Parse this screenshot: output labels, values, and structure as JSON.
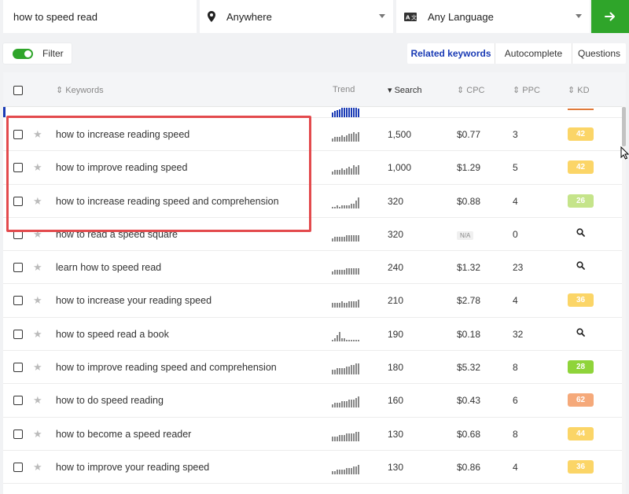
{
  "search": {
    "query": "how to speed read",
    "location": "Anywhere",
    "language": "Any Language"
  },
  "filter": {
    "label": "Filter",
    "enabled": true
  },
  "tabs": [
    {
      "label": "Related keywords",
      "active": true
    },
    {
      "label": "Autocomplete",
      "active": false
    },
    {
      "label": "Questions",
      "active": false
    }
  ],
  "table": {
    "headers": {
      "keywords": "Keywords",
      "trend": "Trend",
      "search": "Search",
      "cpc": "CPC",
      "ppc": "PPC",
      "kd": "KD"
    },
    "rows": [
      {
        "keyword": "how to increase reading speed",
        "search": "1,500",
        "cpc": "$0.77",
        "ppc": "3",
        "kd": "42",
        "kd_color": "#fbd567"
      },
      {
        "keyword": "how to improve reading speed",
        "search": "1,000",
        "cpc": "$1.29",
        "ppc": "5",
        "kd": "42",
        "kd_color": "#fbd567"
      },
      {
        "keyword": "how to increase reading speed and comprehension",
        "search": "320",
        "cpc": "$0.88",
        "ppc": "4",
        "kd": "26",
        "kd_color": "#c5e48a"
      },
      {
        "keyword": "how to read a speed square",
        "search": "320",
        "cpc": "N/A",
        "ppc": "0",
        "kd": "",
        "kd_color": ""
      },
      {
        "keyword": "learn how to speed read",
        "search": "240",
        "cpc": "$1.32",
        "ppc": "23",
        "kd": "",
        "kd_color": ""
      },
      {
        "keyword": "how to increase your reading speed",
        "search": "210",
        "cpc": "$2.78",
        "ppc": "4",
        "kd": "36",
        "kd_color": "#fbd567"
      },
      {
        "keyword": "how to speed read a book",
        "search": "190",
        "cpc": "$0.18",
        "ppc": "32",
        "kd": "",
        "kd_color": ""
      },
      {
        "keyword": "how to improve reading speed and comprehension",
        "search": "180",
        "cpc": "$5.32",
        "ppc": "8",
        "kd": "28",
        "kd_color": "#8fd43a"
      },
      {
        "keyword": "how to do speed reading",
        "search": "160",
        "cpc": "$0.43",
        "ppc": "6",
        "kd": "62",
        "kd_color": "#f5a97a"
      },
      {
        "keyword": "how to become a speed reader",
        "search": "130",
        "cpc": "$0.68",
        "ppc": "8",
        "kd": "44",
        "kd_color": "#fbd567"
      },
      {
        "keyword": "how to improve your reading speed",
        "search": "130",
        "cpc": "$0.86",
        "ppc": "4",
        "kd": "36",
        "kd_color": "#fbd567"
      }
    ]
  },
  "trend_patterns": [
    [
      2,
      3,
      3,
      3,
      4,
      3,
      4,
      5,
      5,
      6,
      5,
      6
    ],
    [
      2,
      3,
      3,
      3,
      4,
      3,
      4,
      5,
      4,
      6,
      5,
      6
    ],
    [
      1,
      1,
      2,
      1,
      2,
      2,
      2,
      2,
      3,
      3,
      5,
      7
    ],
    [
      2,
      3,
      3,
      3,
      3,
      3,
      4,
      4,
      4,
      4,
      4,
      4
    ],
    [
      2,
      3,
      3,
      3,
      3,
      3,
      4,
      4,
      4,
      4,
      4,
      4
    ],
    [
      3,
      3,
      3,
      3,
      4,
      3,
      3,
      4,
      4,
      4,
      4,
      5
    ],
    [
      1,
      2,
      4,
      6,
      2,
      2,
      1,
      1,
      1,
      1,
      1,
      1
    ],
    [
      3,
      3,
      4,
      4,
      4,
      4,
      5,
      5,
      6,
      6,
      7,
      7
    ],
    [
      2,
      3,
      3,
      3,
      4,
      4,
      4,
      5,
      5,
      5,
      6,
      7
    ],
    [
      3,
      3,
      3,
      4,
      4,
      4,
      5,
      5,
      5,
      5,
      6,
      6
    ],
    [
      2,
      2,
      3,
      3,
      3,
      3,
      4,
      4,
      4,
      5,
      5,
      6
    ]
  ]
}
